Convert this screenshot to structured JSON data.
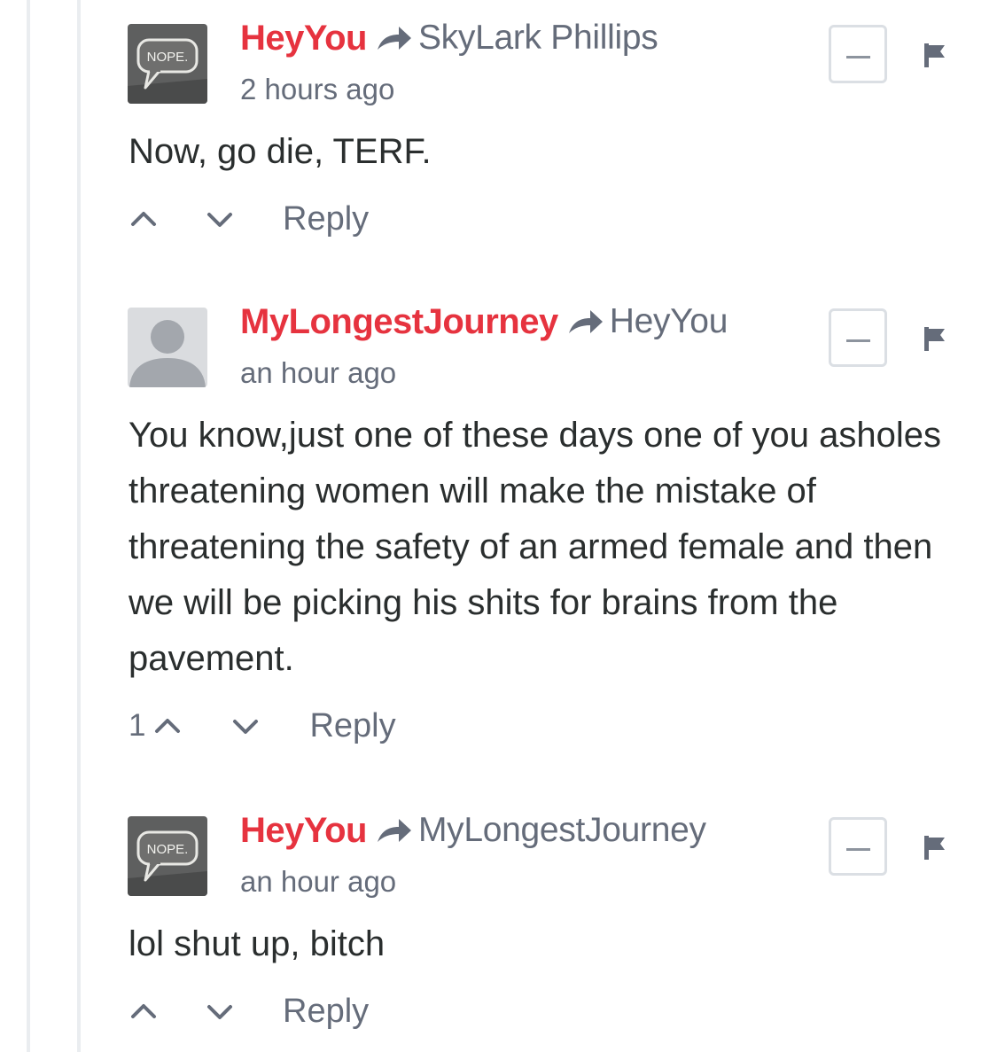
{
  "comments": [
    {
      "author": "HeyYou",
      "recipient": "SkyLark Phillips",
      "timestamp": "2 hours ago",
      "body": "Now, go die, TERF.",
      "votes": "",
      "reply_label": "Reply",
      "avatar": {
        "type": "nope-sign",
        "text": "NOPE."
      }
    },
    {
      "author": "MyLongestJourney",
      "recipient": "HeyYou",
      "timestamp": "an hour ago",
      "body": "You know,just one of these days one of you asholes threatening women will make the mistake of threatening the safety of an armed female and then we will be picking his shits for brains from the pavement.",
      "votes": "1",
      "reply_label": "Reply",
      "avatar": {
        "type": "default-user"
      }
    },
    {
      "author": "HeyYou",
      "recipient": "MyLongestJourney",
      "timestamp": "an hour ago",
      "body": "lol shut up, bitch",
      "votes": "",
      "reply_label": "Reply",
      "avatar": {
        "type": "nope-sign",
        "text": "NOPE."
      }
    }
  ],
  "colors": {
    "author": "#e6333f",
    "meta": "#656c7a",
    "text": "#2a2e2e",
    "thread_line": "#eaedf0"
  },
  "icons": [
    "reply-arrow-icon",
    "collapse-icon",
    "flag-icon",
    "upvote-icon",
    "downvote-icon"
  ]
}
